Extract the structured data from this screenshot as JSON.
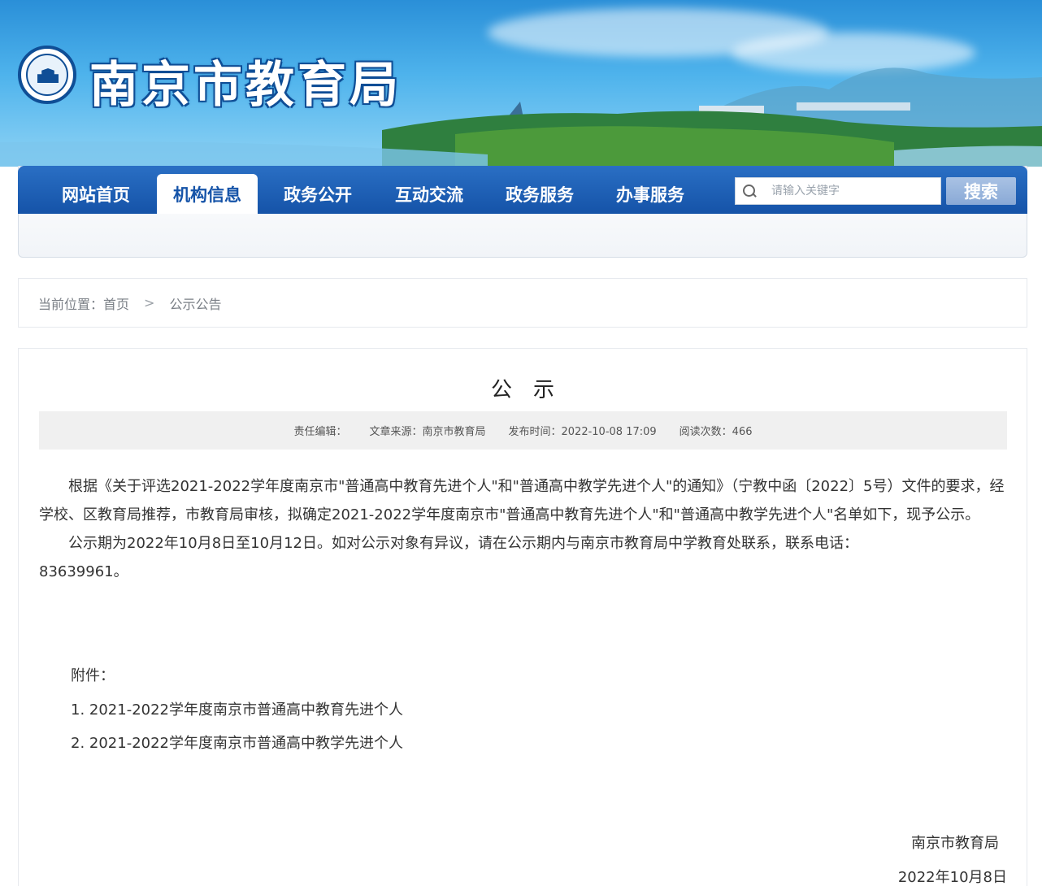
{
  "header": {
    "site_title": "南京市教育局"
  },
  "nav": {
    "items": [
      {
        "label": "网站首页",
        "active": false
      },
      {
        "label": "机构信息",
        "active": true
      },
      {
        "label": "政务公开",
        "active": false
      },
      {
        "label": "互动交流",
        "active": false
      },
      {
        "label": "政务服务",
        "active": false
      },
      {
        "label": "办事服务",
        "active": false
      }
    ],
    "search_placeholder": "请输入关键字",
    "search_button": "搜索"
  },
  "breadcrumb": {
    "prefix": "当前位置：",
    "home": "首页",
    "separator": ">",
    "current": "公示公告"
  },
  "article": {
    "title": "公示",
    "meta": {
      "editor": "责任编辑：",
      "source": "文章来源：南京市教育局",
      "published": "发布时间：2022-10-08 17:09",
      "views": "阅读次数：466"
    },
    "paragraphs": [
      "根据《关于评选2021-2022学年度南京市\"普通高中教育先进个人\"和\"普通高中教学先进个人\"的通知》（宁教中函〔2022〕5号）文件的要求，经学校、区教育局推荐，市教育局审核，拟确定2021-2022学年度南京市\"普通高中教育先进个人\"和\"普通高中教学先进个人\"名单如下，现予公示。",
      "公示期为2022年10月8日至10月12日。如对公示对象有异议，请在公示期内与南京市教育局中学教育处联系，联系电话：83639961。"
    ],
    "attachment_label": "附件：",
    "attachments": [
      "1. 2021-2022学年度南京市普通高中教育先进个人",
      "2. 2021-2022学年度南京市普通高中教学先进个人"
    ],
    "signature": "南京市教育局",
    "date": "2022年10月8日"
  },
  "colors": {
    "nav_blue": "#1553a8",
    "banner_sky": "#4eb3ec"
  }
}
